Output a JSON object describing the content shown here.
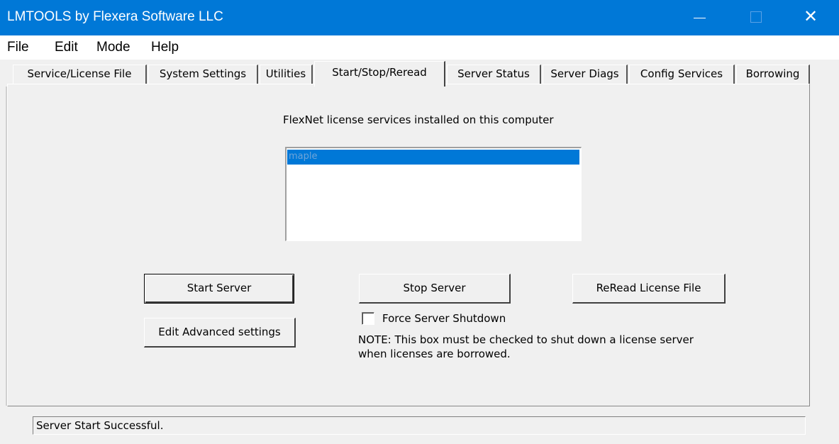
{
  "window": {
    "title": "LMTOOLS by Flexera Software LLC",
    "minimize_icon": "minimize-icon",
    "maximize_icon": "maximize-icon",
    "close_icon": "close-icon",
    "close_glyph": "✕"
  },
  "menu": [
    "File",
    "Edit",
    "Mode",
    "Help"
  ],
  "tabs": [
    {
      "label": "Service/License File",
      "active": false
    },
    {
      "label": "System Settings",
      "active": false
    },
    {
      "label": "Utilities",
      "active": false
    },
    {
      "label": "Start/Stop/Reread",
      "active": true
    },
    {
      "label": "Server Status",
      "active": false
    },
    {
      "label": "Server Diags",
      "active": false
    },
    {
      "label": "Config Services",
      "active": false
    },
    {
      "label": "Borrowing",
      "active": false
    }
  ],
  "main": {
    "services_label": "FlexNet license services installed on this computer",
    "services": [
      {
        "name": "maple",
        "selected": true
      }
    ],
    "start_button": "Start Server",
    "stop_button": "Stop Server",
    "reread_button": "ReRead License File",
    "edit_advanced_button": "Edit Advanced settings",
    "force_shutdown_label": "Force Server Shutdown",
    "force_shutdown_checked": false,
    "note_line1": "NOTE:  This box must be checked to shut down a license server",
    "note_line2": "when licenses are borrowed."
  },
  "status": {
    "text": "Server Start Successful."
  },
  "colors": {
    "titlebar": "#0078d7",
    "selection": "#0078d7"
  }
}
